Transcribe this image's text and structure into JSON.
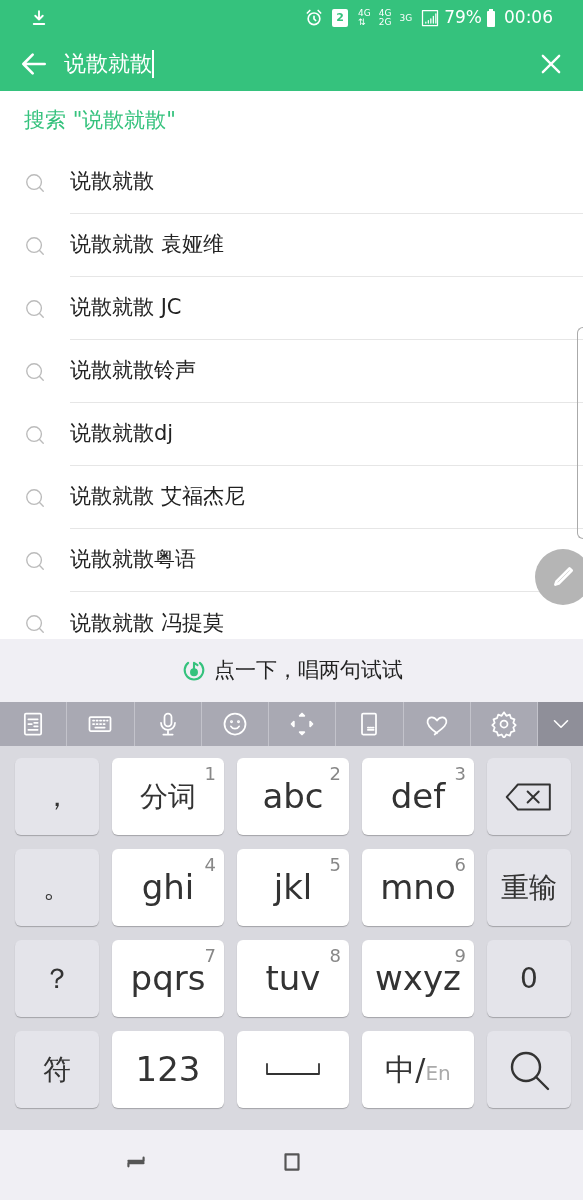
{
  "status_bar": {
    "sim": "2",
    "networks": [
      {
        "top": "4G",
        "bottom": "⇅"
      },
      {
        "top": "4G",
        "bottom": "2G"
      },
      {
        "top": "3G"
      }
    ],
    "battery": "79%",
    "time": "00:06"
  },
  "search": {
    "value": "说散就散"
  },
  "search_action": "搜索 \"说散就散\"",
  "suggestions": [
    "说散就散",
    "说散就散 袁娅维",
    "说散就散 JC",
    "说散就散铃声",
    "说散就散dj",
    "说散就散 艾福杰尼",
    "说散就散粤语",
    "说散就散 冯提莫"
  ],
  "voice_hint": "点一下，唱两句试试",
  "keys": [
    {
      "kind": "text",
      "label": "，"
    },
    {
      "kind": "text",
      "label": "分词",
      "digit": "1"
    },
    {
      "kind": "text",
      "label": "abc",
      "digit": "2"
    },
    {
      "kind": "text",
      "label": "def",
      "digit": "3"
    },
    {
      "kind": "backspace"
    },
    {
      "kind": "text",
      "label": "。"
    },
    {
      "kind": "text",
      "label": "ghi",
      "digit": "4"
    },
    {
      "kind": "text",
      "label": "jkl",
      "digit": "5"
    },
    {
      "kind": "text",
      "label": "mno",
      "digit": "6"
    },
    {
      "kind": "text",
      "label": "重输"
    },
    {
      "kind": "text",
      "label": "？"
    },
    {
      "kind": "text",
      "label": "pqrs",
      "digit": "7"
    },
    {
      "kind": "text",
      "label": "tuv",
      "digit": "8"
    },
    {
      "kind": "text",
      "label": "wxyz",
      "digit": "9"
    },
    {
      "kind": "text",
      "label": "0"
    },
    {
      "kind": "text",
      "label": "符"
    },
    {
      "kind": "text",
      "label": "123"
    },
    {
      "kind": "space"
    },
    {
      "kind": "lang",
      "label": "中/",
      "sub": "En"
    },
    {
      "kind": "search"
    }
  ]
}
